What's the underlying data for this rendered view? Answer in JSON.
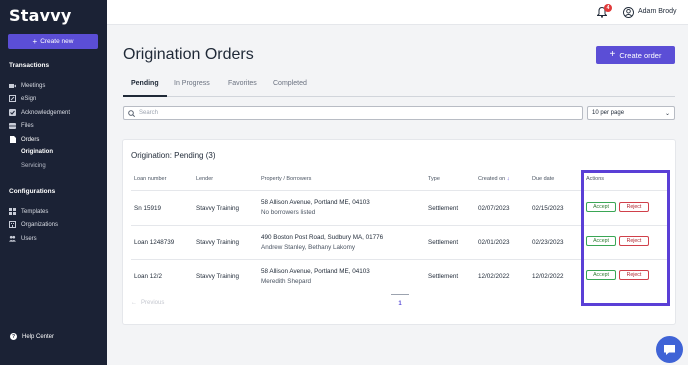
{
  "sidebar": {
    "logo": "Stavvy",
    "create_new": "Create new",
    "sections": {
      "transactions": "Transactions",
      "configurations": "Configurations"
    },
    "transactions_items": [
      {
        "label": "Meetings",
        "icon": "video-icon"
      },
      {
        "label": "eSign",
        "icon": "pen-icon"
      },
      {
        "label": "Acknowledgement",
        "icon": "check-square-icon"
      },
      {
        "label": "Files",
        "icon": "inbox-icon"
      },
      {
        "label": "Orders",
        "icon": "document-icon"
      }
    ],
    "orders_subitems": [
      "Origination",
      "Servicing"
    ],
    "config_items": [
      {
        "label": "Templates",
        "icon": "grid-icon"
      },
      {
        "label": "Organizations",
        "icon": "building-icon"
      },
      {
        "label": "Users",
        "icon": "users-icon"
      }
    ],
    "help": "Help Center"
  },
  "topbar": {
    "notification_count": "4",
    "user_name": "Adam Brody"
  },
  "main": {
    "title": "Origination Orders",
    "create_order": "Create order",
    "tabs": [
      "Pending",
      "In Progress",
      "Favorites",
      "Completed"
    ],
    "search_placeholder": "Search",
    "per_page": "10 per page"
  },
  "table": {
    "title": "Origination: Pending (3)",
    "headers": [
      "Loan number",
      "Lender",
      "Property / Borrowers",
      "Type",
      "Created on",
      "Due date",
      "Actions"
    ],
    "rows": [
      {
        "loan": "Sn 15919",
        "lender": "Stavvy Training",
        "property": "58 Allison Avenue, Portland ME, 04103",
        "borrowers": "No borrowers listed",
        "type": "Settlement",
        "created": "02/07/2023",
        "due": "02/15/2023"
      },
      {
        "loan": "Loan 1248739",
        "lender": "Stavvy Training",
        "property": "490 Boston Post Road, Sudbury MA, 01776",
        "borrowers": "Andrew Stanley, Bethany Lakomy",
        "type": "Settlement",
        "created": "02/01/2023",
        "due": "02/23/2023"
      },
      {
        "loan": "Loan 12/2",
        "lender": "Stavvy Training",
        "property": "58 Allison Avenue, Portland ME, 04103",
        "borrowers": "Meredith Shepard",
        "type": "Settlement",
        "created": "12/02/2022",
        "due": "12/02/2022"
      }
    ],
    "accept_label": "Accept",
    "reject_label": "Reject",
    "previous": "Previous",
    "page": "1"
  }
}
